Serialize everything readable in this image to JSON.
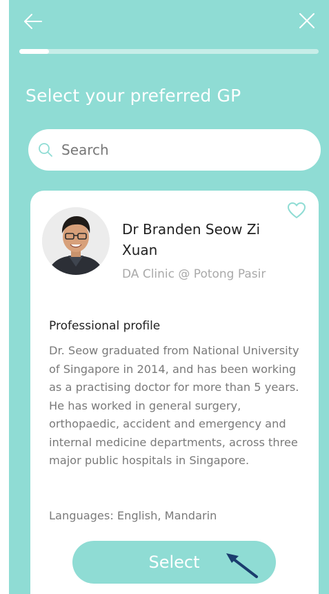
{
  "header": {
    "back_icon": "arrow-left-icon",
    "close_icon": "close-icon",
    "progress": 0.1
  },
  "page_title": "Select your preferred GP",
  "search": {
    "icon": "search-icon",
    "placeholder": "Search",
    "value": ""
  },
  "doctor": {
    "name": "Dr Branden Seow Zi Xuan",
    "clinic": "DA Clinic @ Potong Pasir",
    "favorite_icon": "heart-outline-icon",
    "profile_heading": "Professional profile",
    "profile_text": "Dr. Seow graduated from National University of Singapore in 2014, and has been working as a practising doctor for more than 5 years. He has worked in general surgery, orthopaedic, accident and emergency and internal medicine departments, across three major public hospitals in Singapore.",
    "languages": "Languages: English, Mandarin",
    "select_label": "Select"
  },
  "annotation": {
    "icon": "pointer-arrow-icon",
    "color": "#1a3d6e"
  },
  "colors": {
    "background": "#8fdcd4",
    "card": "#ffffff",
    "accent": "#8fdcd4"
  }
}
